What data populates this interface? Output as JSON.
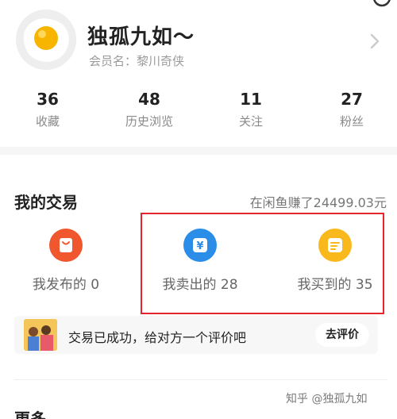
{
  "profile": {
    "name": "独孤九如～",
    "member_label": "会员名：黎川奇侠",
    "stats": [
      {
        "value": "36",
        "label": "收藏"
      },
      {
        "value": "48",
        "label": "历史浏览"
      },
      {
        "value": "11",
        "label": "关注"
      },
      {
        "value": "27",
        "label": "粉丝"
      }
    ]
  },
  "trade": {
    "title": "我的交易",
    "earned": "在闲鱼赚了24499.03元",
    "items": [
      {
        "label": "我发布的 0",
        "icon": "bag-icon",
        "color": "#f0572f"
      },
      {
        "label": "我卖出的 28",
        "icon": "yen-icon",
        "color": "#2a8de8"
      },
      {
        "label": "我买到的 35",
        "icon": "receipt-icon",
        "color": "#f9b81c"
      }
    ],
    "notice": {
      "text": "交易已成功，给对方一个评价吧",
      "button": "去评价"
    }
  },
  "more": {
    "title": "更多"
  },
  "watermark": "知乎 @独孤九如"
}
